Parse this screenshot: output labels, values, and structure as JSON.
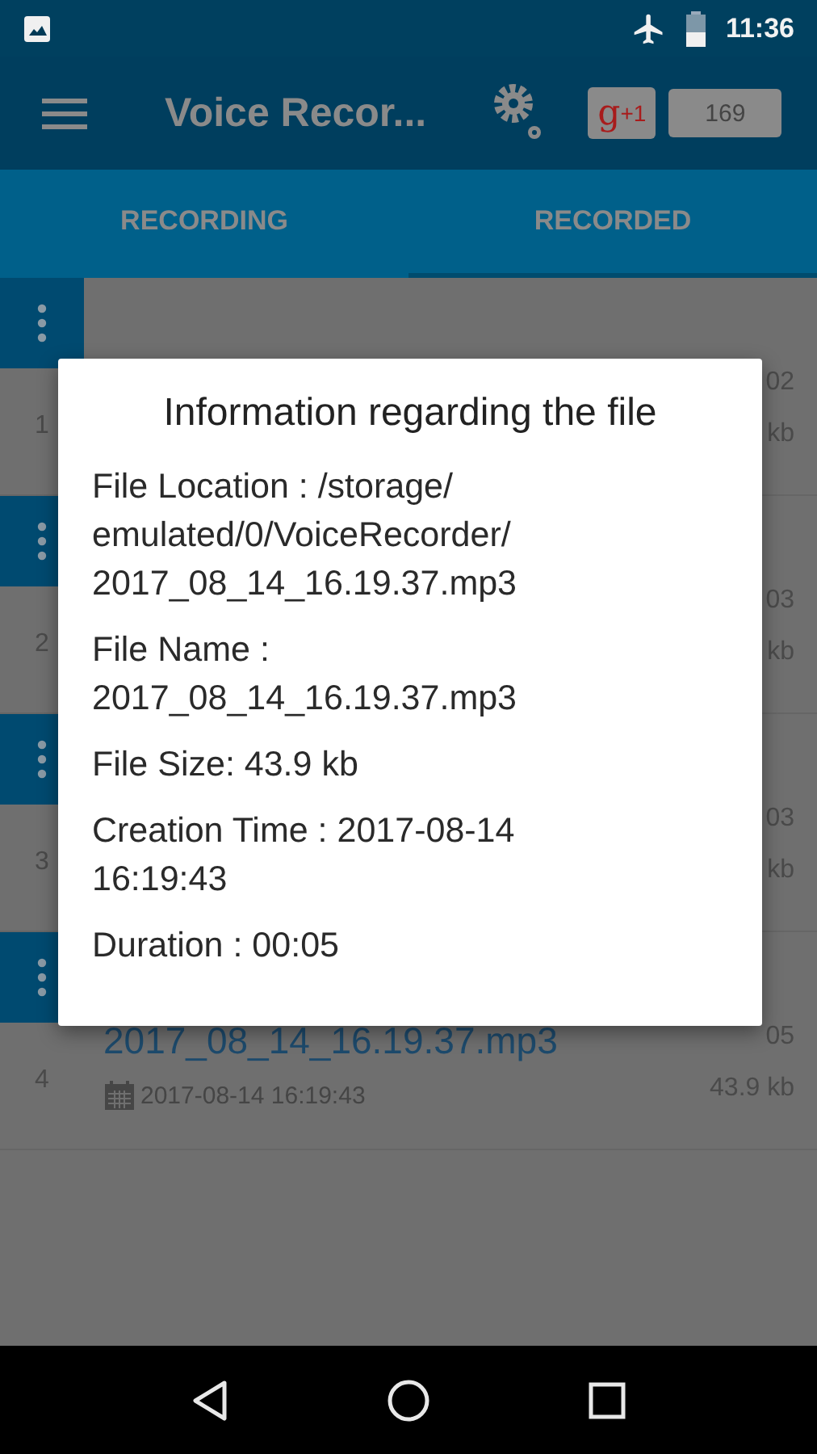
{
  "status_bar": {
    "time": "11:36"
  },
  "app_bar": {
    "title": "Voice Recor...",
    "plus_g": "g",
    "plus_one": "+1",
    "plus_count": "169"
  },
  "tabs": [
    {
      "label": "RECORDING",
      "selected": false
    },
    {
      "label": "RECORDED",
      "selected": true
    }
  ],
  "recordings": [
    {
      "number": "1",
      "duration": "02",
      "size": "kb"
    },
    {
      "number": "2",
      "duration": "03",
      "size": "kb"
    },
    {
      "number": "3",
      "duration": "03",
      "size": "kb"
    },
    {
      "number": "4",
      "duration": "05",
      "size": "43.9 kb",
      "file_name": "2017_08_14_16.19.37.mp3",
      "date": "2017-08-14 16:19:43"
    }
  ],
  "dialog": {
    "title": "Information regarding the file",
    "fields": [
      {
        "lines": [
          "File Location : /storage/",
          "emulated/0/VoiceRecorder/",
          "2017_08_14_16.19.37.mp3"
        ]
      },
      {
        "lines": [
          "File Name :",
          "2017_08_14_16.19.37.mp3"
        ]
      },
      {
        "lines": [
          "File Size: 43.9 kb"
        ]
      },
      {
        "lines": [
          "Creation Time : 2017-08-14",
          "16:19:43"
        ]
      },
      {
        "lines": [
          "Duration : 00:05"
        ]
      }
    ]
  }
}
